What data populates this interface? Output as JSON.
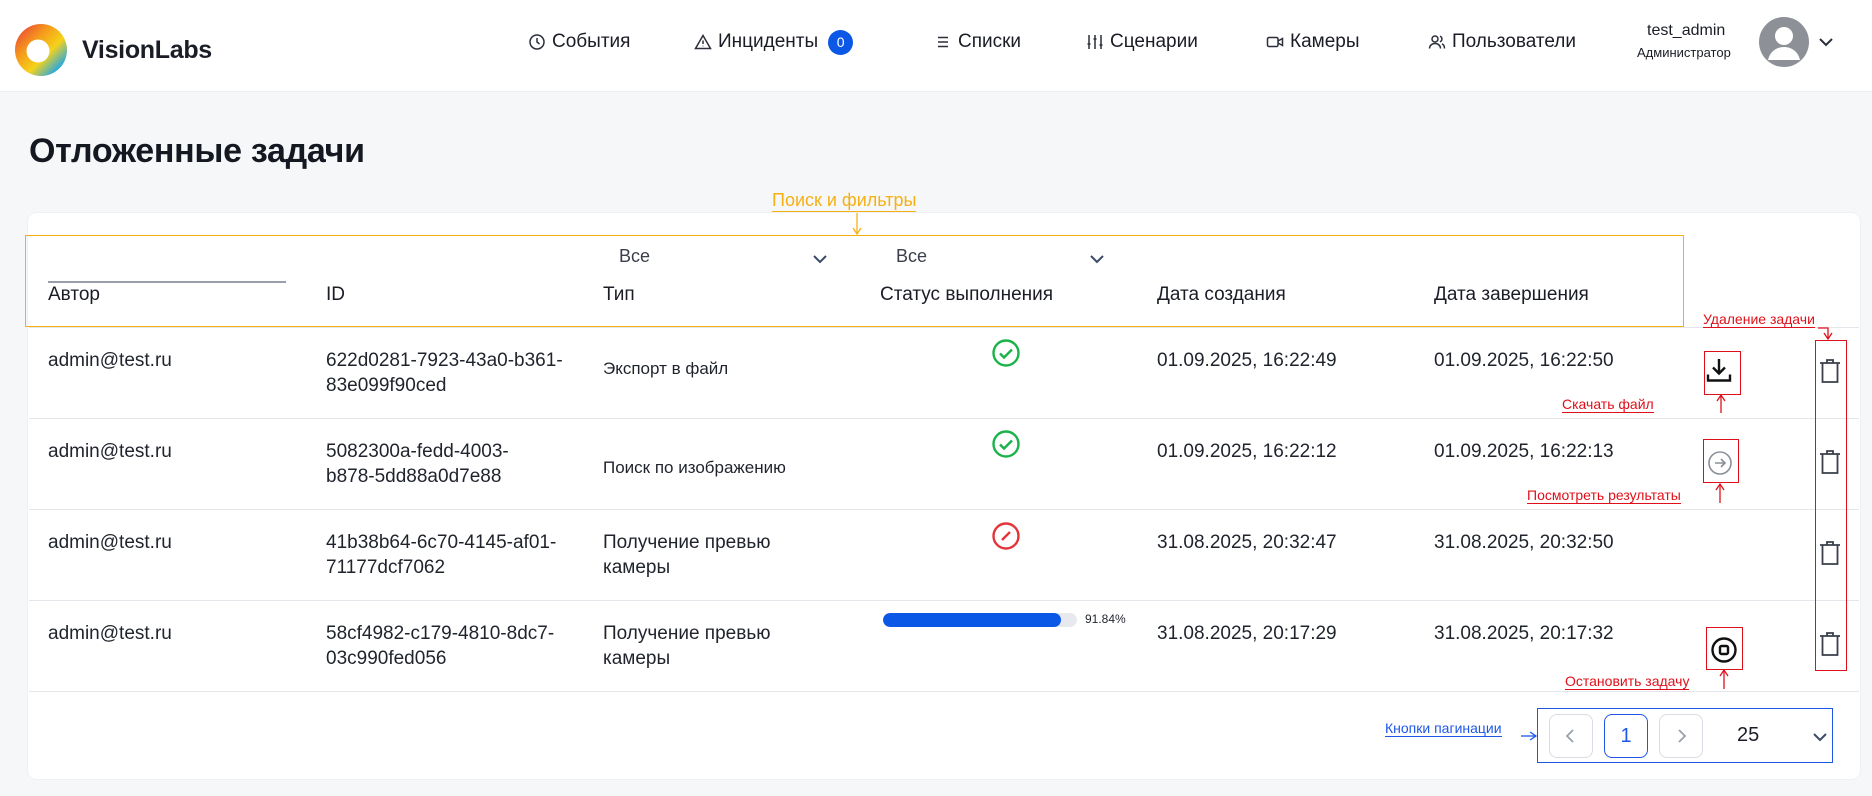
{
  "header": {
    "brand": "VisionLabs",
    "nav": [
      {
        "label": "События",
        "icon": "clock-icon"
      },
      {
        "label": "Инциденты",
        "icon": "warning-icon",
        "badge": "0"
      },
      {
        "label": "Списки",
        "icon": "list-icon"
      },
      {
        "label": "Сценарии",
        "icon": "sliders-icon"
      },
      {
        "label": "Камеры",
        "icon": "video-icon"
      },
      {
        "label": "Пользователи",
        "icon": "users-icon"
      }
    ],
    "user": {
      "name": "test_admin",
      "role": "Администратор"
    }
  },
  "page": {
    "title": "Отложенные задачи"
  },
  "filters": {
    "type_value": "Все",
    "status_value": "Все"
  },
  "columns": [
    "Автор",
    "ID",
    "Тип",
    "Статус выполнения",
    "Дата создания",
    "Дата завершения"
  ],
  "rows": [
    {
      "author": "admin@test.ru",
      "id_line1": "622d0281-7923-43a0-b361-",
      "id_line2": "83e099f90ced",
      "type": "Экспорт в файл",
      "status": "success",
      "created": "01.09.2025, 16:22:49",
      "finished": "01.09.2025, 16:22:50",
      "action": "download-icon"
    },
    {
      "author": "admin@test.ru",
      "id_line1": "5082300a-fedd-4003-",
      "id_line2": "b878-5dd88a0d7e88",
      "type": "Поиск по изображению",
      "status": "success",
      "created": "01.09.2025, 16:22:12",
      "finished": "01.09.2025, 16:22:13",
      "action": "arrow-right-circle-icon"
    },
    {
      "author": "admin@test.ru",
      "id_line1": "41b38b64-6c70-4145-af01-",
      "id_line2": "71177dcf7062",
      "type_line1": "Получение превью",
      "type_line2": "камеры",
      "status": "failed",
      "created": "31.08.2025, 20:32:47",
      "finished": "31.08.2025, 20:32:50"
    },
    {
      "author": "admin@test.ru",
      "id_line1": "58cf4982-c179-4810-8dc7-",
      "id_line2": "03c990fed056",
      "type_line1": "Получение превью",
      "type_line2": "камеры",
      "status": "in-progress",
      "progress": 0.9184,
      "progress_label": "91.84%",
      "created": "31.08.2025, 20:17:29",
      "finished": "31.08.2025, 20:17:32",
      "action": "stop-icon"
    }
  ],
  "pagination": {
    "current": "1",
    "page_size": "25"
  },
  "annotations": {
    "filters": "Поиск и фильтры",
    "delete": "Удаление задачи",
    "download": "Скачать файл",
    "view": "Посмотреть результаты",
    "stop": "Остановить задачу",
    "pagination": "Кнопки пагинации"
  },
  "colors": {
    "accent": "#0b58e6",
    "success": "#1ab34a",
    "fail": "#e3343a",
    "annotation_red": "#e0101a",
    "annotation_orange": "#f5b014",
    "annotation_blue": "#1e57e8"
  }
}
